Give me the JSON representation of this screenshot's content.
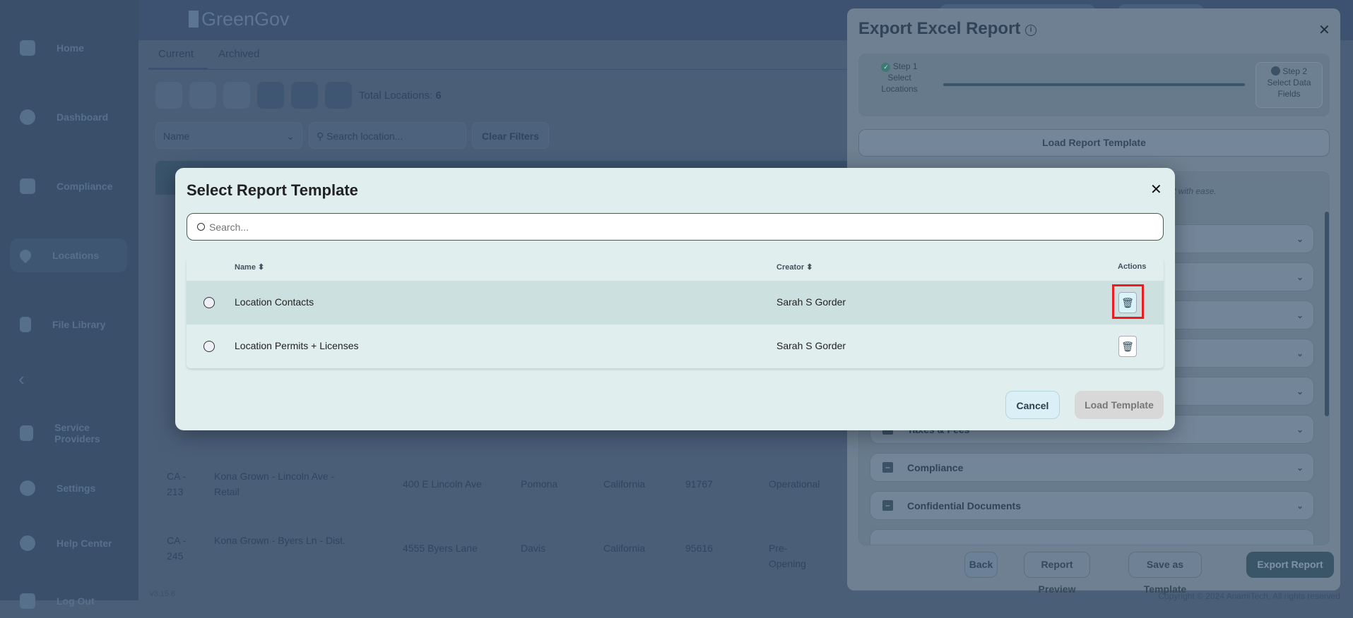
{
  "app": {
    "logo": "GreenGov",
    "version": "v3.15.6",
    "copyright": "Copyright © 2024 AnamiTech, All rights reserved"
  },
  "sidebar": {
    "items": [
      {
        "label": "Home"
      },
      {
        "label": "Dashboard"
      },
      {
        "label": "Compliance"
      },
      {
        "label": "Locations",
        "selected": true
      },
      {
        "label": "File Library"
      },
      {
        "label": "Service Providers"
      },
      {
        "label": "Settings"
      },
      {
        "label": "Help Center"
      },
      {
        "label": "Log Out"
      }
    ]
  },
  "tabs": [
    {
      "label": "Current",
      "active": true
    },
    {
      "label": "Archived"
    }
  ],
  "toolbar": {
    "total_label": "Total Locations:",
    "total_value": "6"
  },
  "filters": {
    "field": "Name",
    "search_placeholder": "Search location...",
    "clear": "Clear Filters"
  },
  "table": {
    "rows": [
      {
        "id": "CA - 213",
        "name": "Kona Grown - Lincoln Ave - Retail",
        "address": "400 E Lincoln Ave",
        "city": "Pomona",
        "state": "California",
        "zip": "91767",
        "status": "Operational"
      },
      {
        "id": "CA - 245",
        "name": "Kona Grown - Byers Ln - Dist.",
        "address": "4555 Byers Lane",
        "city": "Davis",
        "state": "California",
        "zip": "95616",
        "status": "Pre-Opening"
      }
    ]
  },
  "export": {
    "title": "Export Excel Report",
    "step1": {
      "title": "Step 1",
      "label": "Select Locations"
    },
    "step2": {
      "title": "Step 2",
      "label": "Select Data Fields"
    },
    "load_template": "Load Report Template",
    "info_fragment": "t with ease.",
    "sections": [
      "Taxes & Fees",
      "Compliance",
      "Confidential Documents"
    ],
    "buttons": {
      "back": "Back",
      "preview": "Report Preview",
      "save": "Save as Template",
      "export": "Export Report"
    }
  },
  "modal": {
    "title": "Select Report Template",
    "search_placeholder": "Search...",
    "columns": {
      "name": "Name",
      "creator": "Creator",
      "actions": "Actions"
    },
    "rows": [
      {
        "name": "Location Contacts",
        "creator": "Sarah S Gorder"
      },
      {
        "name": "Location Permits + Licenses",
        "creator": "Sarah S Gorder"
      }
    ],
    "cancel": "Cancel",
    "load": "Load Template"
  }
}
